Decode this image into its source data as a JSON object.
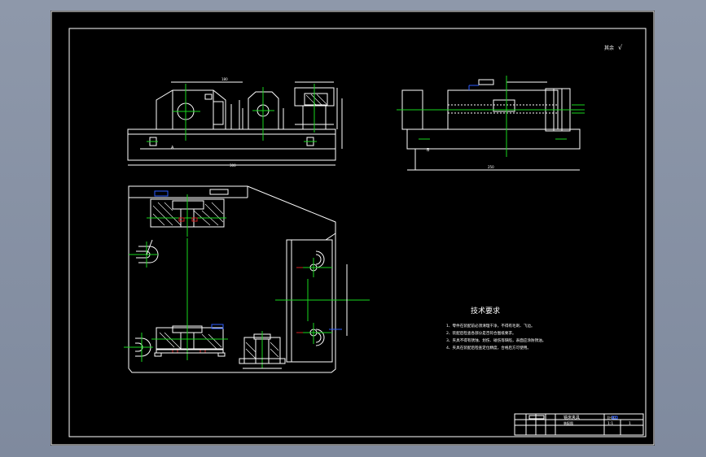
{
  "drawing": {
    "roughness_mark": "其余",
    "roughness_value": "√",
    "section_label_top": "A",
    "section_label_side": "B",
    "tech_requirements": {
      "title": "技术要求",
      "items": [
        "1、零件在装配前必须清理干净，不得有毛刺、飞边。",
        "2、装配后检查各部分是否符合图纸要求。",
        "3、夹具不得有锈蚀、划伤、碰伤等缺陷，表面应涂防锈油。",
        "4、夹具在装配后检查定位精度，合格后方可使用。"
      ]
    },
    "title_block": {
      "name": "铣床夹具",
      "drawing_no": "JJ-00",
      "company": "装配图",
      "scale": "1:1",
      "sheet": "1"
    }
  },
  "colors": {
    "background": "#000000",
    "lines": "#ffffff",
    "centerlines": "#19d61e",
    "dimensions": "#2c5cff",
    "highlights": "#d02020"
  }
}
